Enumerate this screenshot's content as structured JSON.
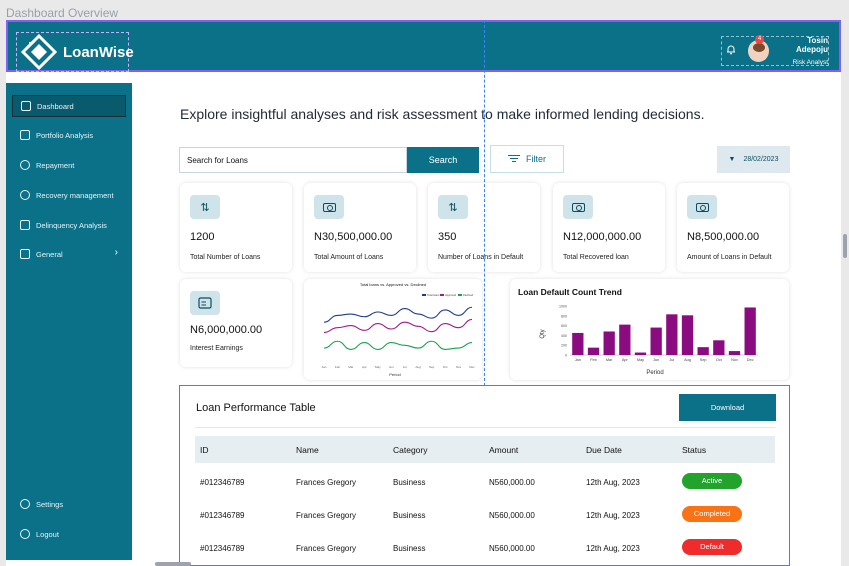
{
  "canvas_label": "Dashboard Overview",
  "header": {
    "brand": "LoanWise",
    "notification_count": "4",
    "user_name": "Tosin Adepoju",
    "user_role": "Risk Analyst"
  },
  "sidebar": {
    "items": [
      {
        "label": "Dashboard",
        "icon": "home-icon"
      },
      {
        "label": "Portfolio Analysis",
        "icon": "chart-icon"
      },
      {
        "label": "Repayment",
        "icon": "repayment-icon"
      },
      {
        "label": "Recovery management",
        "icon": "recovery-icon"
      },
      {
        "label": "Delinquency Analysis",
        "icon": "grid-icon"
      },
      {
        "label": "General",
        "icon": "book-icon"
      }
    ],
    "settings": "Settings",
    "logout": "Logout"
  },
  "headline": "Explore insightful analyses and risk assessment to make informed lending decisions.",
  "search": {
    "placeholder": "Search  for Loans",
    "button": "Search"
  },
  "filter_label": "Filter",
  "date": "28/02/2023",
  "cards": [
    {
      "value": "1200",
      "label": "Total Number of Loans",
      "icon": "arrows-updown-icon"
    },
    {
      "value": "N30,500,000.00",
      "label": "Total Amount of Loans",
      "icon": "money-icon"
    },
    {
      "value": "350",
      "label": "Number of Loans in Default",
      "icon": "arrows-updown-icon"
    },
    {
      "value": "N12,000,000.00",
      "label": "Total Recovered loan",
      "icon": "money-icon"
    },
    {
      "value": "N8,500,000.00",
      "label": "Amount of Loans in Default",
      "icon": "money-icon"
    },
    {
      "value": "N6,000,000.00",
      "label": "Interest Earnings",
      "icon": "invoice-icon"
    }
  ],
  "chart_data": [
    {
      "type": "line",
      "title": "Total loans vs. Approved vs. Declined",
      "xlabel": "Period",
      "ylabel": "",
      "categories": [
        "Jan",
        "Feb",
        "Mar",
        "Apr",
        "May",
        "Jun",
        "Jul",
        "Aug",
        "Sep",
        "Oct",
        "Nov",
        "Dec"
      ],
      "series": [
        {
          "name": "Total loans",
          "color": "#1e3a8a",
          "values": [
            60,
            70,
            72,
            68,
            75,
            70,
            80,
            72,
            66,
            78,
            70,
            82
          ]
        },
        {
          "name": "Approved",
          "color": "#9d1b8d",
          "values": [
            45,
            52,
            55,
            48,
            58,
            50,
            60,
            54,
            46,
            58,
            52,
            64
          ]
        },
        {
          "name": "Declined",
          "color": "#16a34a",
          "values": [
            22,
            32,
            20,
            30,
            20,
            30,
            26,
            22,
            32,
            20,
            22,
            30
          ]
        }
      ],
      "ylim": [
        0,
        100
      ]
    },
    {
      "type": "bar",
      "title": "Loan Default Count Trend",
      "xlabel": "Period",
      "ylabel": "Qty",
      "categories": [
        "Jan",
        "Feb",
        "Mar",
        "Apr",
        "May",
        "Jun",
        "Jul",
        "Aug",
        "Sep",
        "Oct",
        "Nov",
        "Dec"
      ],
      "values": [
        450,
        150,
        480,
        620,
        50,
        560,
        830,
        810,
        160,
        300,
        80,
        970
      ],
      "ylim": [
        0,
        1000
      ],
      "yticks": [
        "0",
        "200",
        "400",
        "600",
        "800",
        "1000"
      ],
      "color": "#8b0b80"
    }
  ],
  "table": {
    "title": "Loan Performance Table",
    "download": "Download",
    "columns": [
      "ID",
      "Name",
      "Category",
      "Amount",
      "Due Date",
      "Status"
    ],
    "rows": [
      {
        "id": "#012346789",
        "name": "Frances Gregory",
        "category": "Business",
        "amount": "N560,000.00",
        "due": "12th Aug, 2023",
        "status": "Active",
        "status_color": "#22a32b"
      },
      {
        "id": "#012346789",
        "name": "Frances Gregory",
        "category": "Business",
        "amount": "N560,000.00",
        "due": "12th Aug, 2023",
        "status": "Completed",
        "status_color": "#f97316"
      },
      {
        "id": "#012346789",
        "name": "Frances Gregory",
        "category": "Business",
        "amount": "N560,000.00",
        "due": "12th Aug, 2023",
        "status": "Default",
        "status_color": "#ef2b2b"
      }
    ]
  }
}
